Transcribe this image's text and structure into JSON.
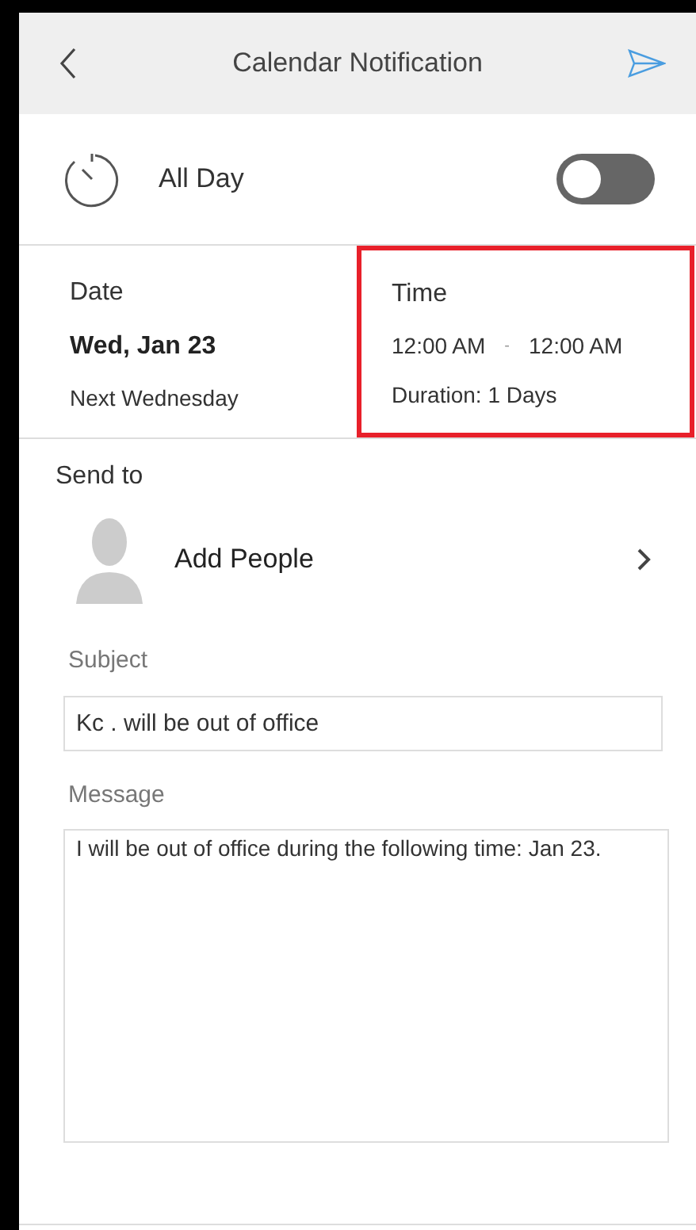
{
  "header": {
    "title": "Calendar Notification"
  },
  "all_day": {
    "label": "All Day",
    "on": false
  },
  "date": {
    "label": "Date",
    "value": "Wed, Jan 23",
    "note": "Next Wednesday"
  },
  "time": {
    "label": "Time",
    "start": "12:00 AM",
    "separator": "-",
    "end": "12:00 AM",
    "duration": "Duration: 1 Days",
    "highlighted": true
  },
  "send_to": {
    "label": "Send to",
    "action": "Add People"
  },
  "subject": {
    "label": "Subject",
    "value": "Kc . will be out of office"
  },
  "message": {
    "label": "Message",
    "value": "I will be out of office during the following time: Jan 23."
  }
}
